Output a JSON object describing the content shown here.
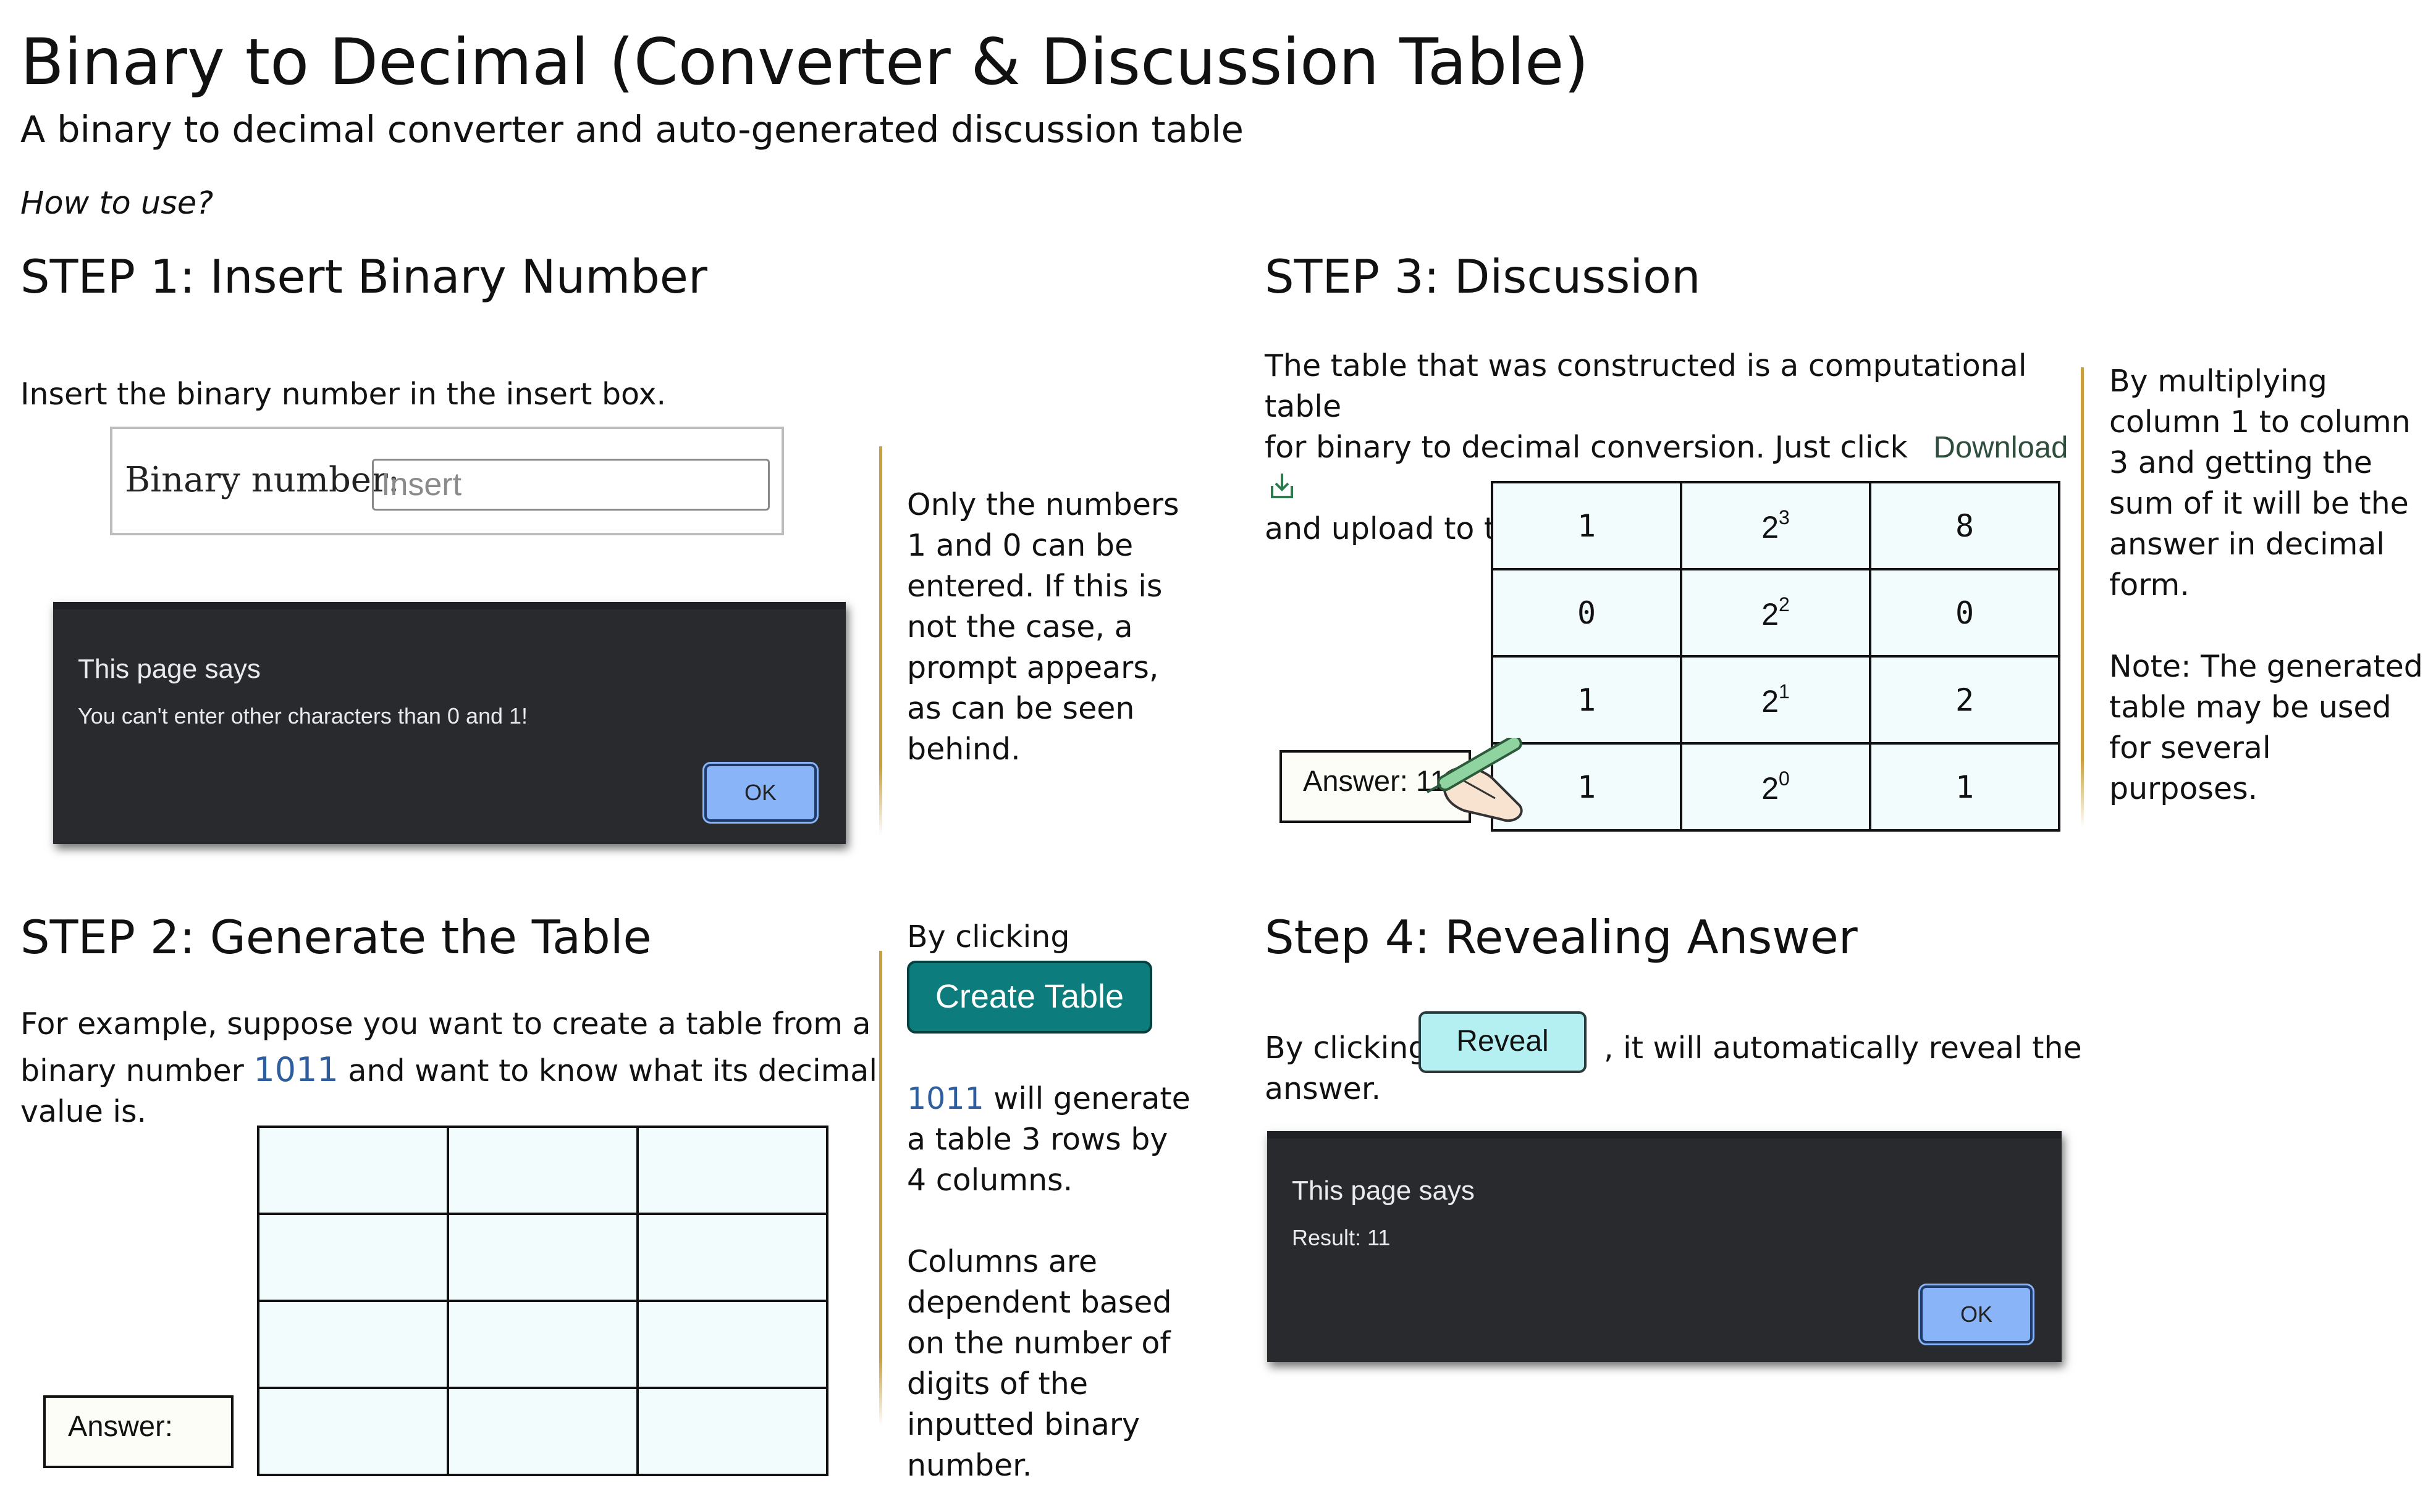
{
  "page": {
    "title": "Binary to Decimal (Converter & Discussion Table)",
    "subtitle": "A binary to decimal converter and auto-generated discussion table",
    "how_to": "How to use?"
  },
  "step1": {
    "heading": "STEP 1: Insert Binary Number",
    "instruction": "Insert the binary number in the insert box.",
    "input_label": "Binary number:",
    "input_placeholder": "Insert",
    "dialog": {
      "title": "This page says",
      "message": "You can't enter other characters than 0 and 1!",
      "ok": "OK"
    },
    "side_note": [
      "Only the numbers",
      "1 and 0 can be",
      "entered. If this is",
      "not the case, a",
      "prompt appears,",
      "as can be seen",
      "behind."
    ]
  },
  "step2": {
    "heading": "STEP 2: Generate the Table",
    "example_line1": "For example, suppose you want to create a table from a",
    "example_line2_pre": "binary number ",
    "example_number": "1011",
    "example_line2_post": " and want to know what its decimal",
    "example_line3": "value is.",
    "answer_label": "Answer:",
    "side_by_clicking": "By clicking",
    "create_button": "Create Table",
    "side_number": "1011",
    "side_gen_line1": " will generate",
    "side_gen_rest": [
      "a table 3 rows by",
      "4 columns."
    ],
    "side_columns": [
      "Columns are",
      "dependent based",
      "on the number of",
      "digits of the",
      "inputted binary",
      "number."
    ]
  },
  "step3": {
    "heading": "STEP 3: Discussion",
    "text_line1": "The table that was constructed is a computational table",
    "text_line2": "for binary to decimal conversion. Just click",
    "download_label": "Download",
    "download_icon": "download-icon",
    "text_line3": "and upload to the main canvas",
    "answer_label": "Answer: 11",
    "hand_icon": "hand-pen-icon",
    "rows": [
      {
        "bit": "1",
        "base": "2",
        "exp": "3",
        "value": "8"
      },
      {
        "bit": "0",
        "base": "2",
        "exp": "2",
        "value": "0"
      },
      {
        "bit": "1",
        "base": "2",
        "exp": "1",
        "value": "2"
      },
      {
        "bit": "1",
        "base": "2",
        "exp": "0",
        "value": "1"
      }
    ],
    "side_note": [
      "By multiplying",
      "column 1 to column",
      "3 and getting the",
      "sum of it will be the",
      "answer in decimal",
      "form."
    ],
    "side_note2": [
      "Note: The generated",
      "table may be used",
      "for several purposes."
    ]
  },
  "step4": {
    "heading": "Step 4: Revealing Answer",
    "pre": "By clicking",
    "reveal_button": "Reveal",
    "post": ", it will automatically reveal the",
    "line2": "answer.",
    "dialog": {
      "title": "This page says",
      "message": "Result: 11",
      "ok": "OK"
    }
  },
  "colors": {
    "accent_line": "#c8a040",
    "create_button": "#0c7c7c",
    "reveal_button": "#b4f0f2",
    "ok_button": "#8ab4f8",
    "dialog_bg": "#292a2d",
    "table_cell": "#f3fcfd",
    "number_blue": "#2e5e9e"
  }
}
